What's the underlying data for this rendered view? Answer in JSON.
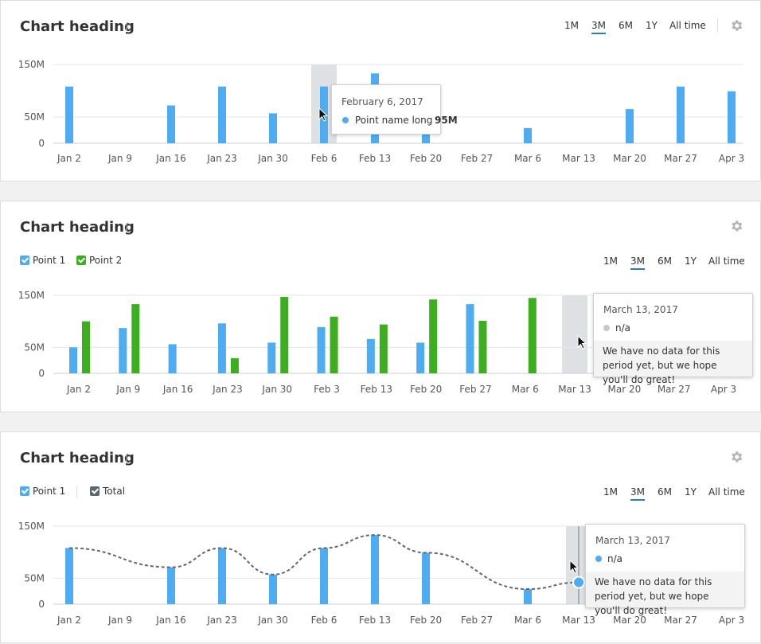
{
  "colors": {
    "blue": "#4eacf0",
    "green": "#3cae1f",
    "grid": "#e6e6e6",
    "highlight": "#dde1e3",
    "line": "#666666",
    "na": "#c8c8c8",
    "accent": "#2d7bc4"
  },
  "icons": {
    "info": "info-icon",
    "settings": "gear-icon",
    "cursor": "mouse-cursor-icon"
  },
  "cards": [
    {
      "title": "Chart heading",
      "info_glyph": "i",
      "periods": [
        "1M",
        "3M",
        "6M",
        "1Y",
        "All time"
      ],
      "active_period": "3M"
    },
    {
      "title": "Chart heading",
      "info_glyph": "i",
      "legend": [
        {
          "label": "Point 1",
          "checked": true
        },
        {
          "label": "Point 2",
          "checked": true
        }
      ],
      "periods": [
        "1M",
        "3M",
        "6M",
        "1Y",
        "All time"
      ],
      "active_period": "3M"
    },
    {
      "title": "Chart heading",
      "info_glyph": "i",
      "legend": [
        {
          "label": "Point 1",
          "checked": true
        },
        {
          "label": "Total",
          "checked": true
        }
      ],
      "periods": [
        "1M",
        "3M",
        "6M",
        "1Y",
        "All time"
      ],
      "active_period": "3M"
    }
  ],
  "tooltips": [
    {
      "date": "February 6, 2017",
      "series": "Point name long",
      "value": "95M"
    },
    {
      "date": "March 13, 2017",
      "series": "n/a",
      "note": "We have no data for this period yet, but we hope you'll do great!"
    },
    {
      "date": "March 13, 2017",
      "series": "n/a",
      "note": "We have no data for this period yet, but we hope you'll do great!"
    }
  ],
  "chart_data": [
    {
      "type": "bar",
      "yticks": [
        "150M",
        "50M",
        "0"
      ],
      "ylim": [
        0,
        150
      ],
      "categories": [
        "Jan 2",
        "Jan 9",
        "Jan 16",
        "Jan 23",
        "Jan 30",
        "Feb 6",
        "Feb 13",
        "Feb 20",
        "Feb 27",
        "Mar 6",
        "Mar 13",
        "Mar 20",
        "Mar 27",
        "Apr 3"
      ],
      "series": [
        {
          "color": "#4eacf0",
          "values": [
            108,
            null,
            72,
            108,
            57,
            108,
            133,
            21,
            null,
            29,
            null,
            65,
            108,
            99
          ]
        }
      ],
      "highlight_index": 5,
      "grid": true
    },
    {
      "type": "bar",
      "yticks": [
        "150M",
        "50M",
        "0"
      ],
      "ylim": [
        0,
        150
      ],
      "categories": [
        "Jan 2",
        "Jan 9",
        "Jan 16",
        "Jan 23",
        "Jan 30",
        "Feb 3",
        "Feb 13",
        "Feb 20",
        "Feb 27",
        "Mar 6",
        "Mar 13",
        "Mar 20",
        "Mar 27",
        "Apr 3"
      ],
      "series": [
        {
          "name": "Point 1",
          "color": "#4eacf0",
          "values": [
            50,
            87,
            56,
            96,
            59,
            89,
            66,
            59,
            133,
            null,
            null,
            null,
            null,
            null
          ]
        },
        {
          "name": "Point 2",
          "color": "#3cae1f",
          "values": [
            100,
            133,
            null,
            29,
            147,
            109,
            94,
            142,
            101,
            145,
            null,
            null,
            null,
            null
          ]
        }
      ],
      "highlight_index": 10,
      "grid": true
    },
    {
      "type": "bar",
      "yticks": [
        "150M",
        "50M",
        "0"
      ],
      "ylim": [
        0,
        150
      ],
      "categories": [
        "Jan 2",
        "Jan 9",
        "Jan 16",
        "Jan 23",
        "Jan 30",
        "Feb 6",
        "Feb 13",
        "Feb 20",
        "Feb 27",
        "Mar 6",
        "Mar 13",
        "Mar 20",
        "Mar 27",
        "Apr 3"
      ],
      "series": [
        {
          "name": "Point 1",
          "color": "#4eacf0",
          "values": [
            108,
            null,
            71,
            108,
            57,
            108,
            133,
            99,
            null,
            29,
            null,
            null,
            null,
            null
          ]
        },
        {
          "name": "Total",
          "type": "line",
          "color": "#666666",
          "values": [
            108,
            null,
            71,
            108,
            57,
            108,
            133,
            99,
            null,
            29,
            42,
            null,
            null,
            null
          ]
        }
      ],
      "highlight_index": 10,
      "grid": true
    }
  ]
}
